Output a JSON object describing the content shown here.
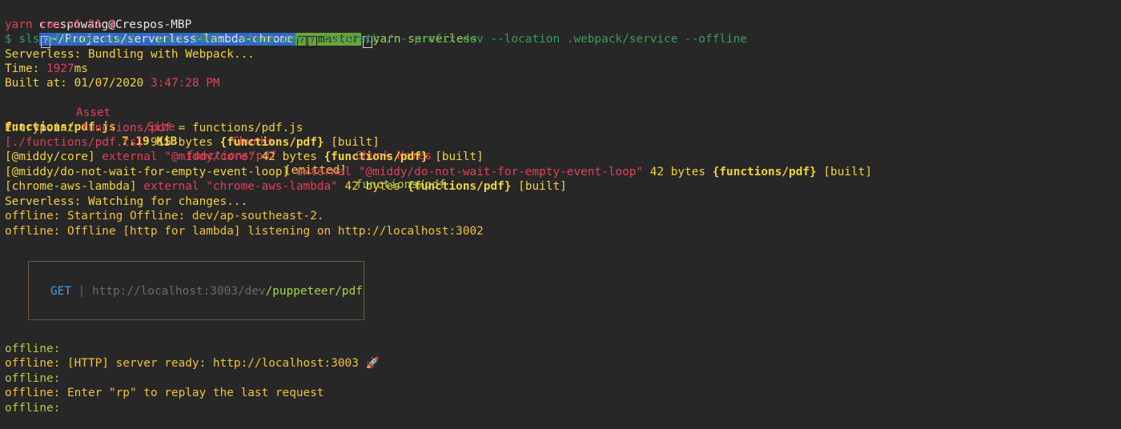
{
  "prompt": {
    "user_host": "crespowang@Crespos-MBP",
    "path_icon": "?",
    "path": "~/Projects/serverless-lambda-chrome",
    "git_icon": "?",
    "branch_icon": "?",
    "branch": "master",
    "arrow_icon": "?",
    "command": "yarn serverless"
  },
  "output": {
    "yarn_version": "yarn run v1.21.1",
    "sls_command": "$ sls offline start --port 3003 --stage dev --basePath / --prefix dev --location .webpack/service --offline",
    "bundling": "Serverless: Bundling with Webpack...",
    "time_label": "Time: ",
    "time_value": "1927",
    "time_unit": "ms",
    "built_label": "Built at: 01/07/2020 ",
    "built_time": "3:47:28 PM",
    "table_header": {
      "asset": "Asset",
      "size": "Size",
      "chunks": "Chunks",
      "chunk_names": "Chunk Names"
    },
    "asset_row": {
      "asset": "functions/pdf.js",
      "size": "7.19 KiB",
      "chunks": "functions/pdf",
      "flag": "[emitted]",
      "chunk_names": "functions/pdf"
    },
    "entrypoint": {
      "label": "Entrypoint ",
      "name": "functions/pdf",
      "rest": " = functions/pdf.js"
    },
    "modules": [
      {
        "path": "[./functions/pdf.ts]",
        "external": "",
        "size": " 915 bytes ",
        "chunk": "{functions/pdf}",
        "built": " [built]"
      },
      {
        "path": "[@middy/core]",
        "external": " external \"@middy/core\"",
        "size": " 42 bytes ",
        "chunk": "{functions/pdf}",
        "built": " [built]"
      },
      {
        "path": "[@middy/do-not-wait-for-empty-event-loop]",
        "external": " external \"@middy/do-not-wait-for-empty-event-loop\"",
        "size": " 42 bytes ",
        "chunk": "{functions/pdf}",
        "built": " [built]"
      },
      {
        "path": "[chrome-aws-lambda]",
        "external": " external \"chrome-aws-lambda\"",
        "size": " 42 bytes ",
        "chunk": "{functions/pdf}",
        "built": " [built]"
      }
    ],
    "watching": "Serverless: Watching for changes...",
    "offline_start": "offline: Starting Offline: dev/ap-southeast-2.",
    "offline_lambda": "offline: Offline [http for lambda] listening on http://localhost:3002",
    "route": {
      "method": "GET",
      "separator": " | ",
      "base": "http://localhost:3003/dev",
      "path": "/puppeteer/pdf"
    },
    "offline_prefix": "offline:",
    "offline_ready": "offline: [HTTP] server ready: http://localhost:3003 ",
    "rocket": "🚀",
    "offline_replay": "offline: Enter \"rp\" to replay the last request"
  }
}
